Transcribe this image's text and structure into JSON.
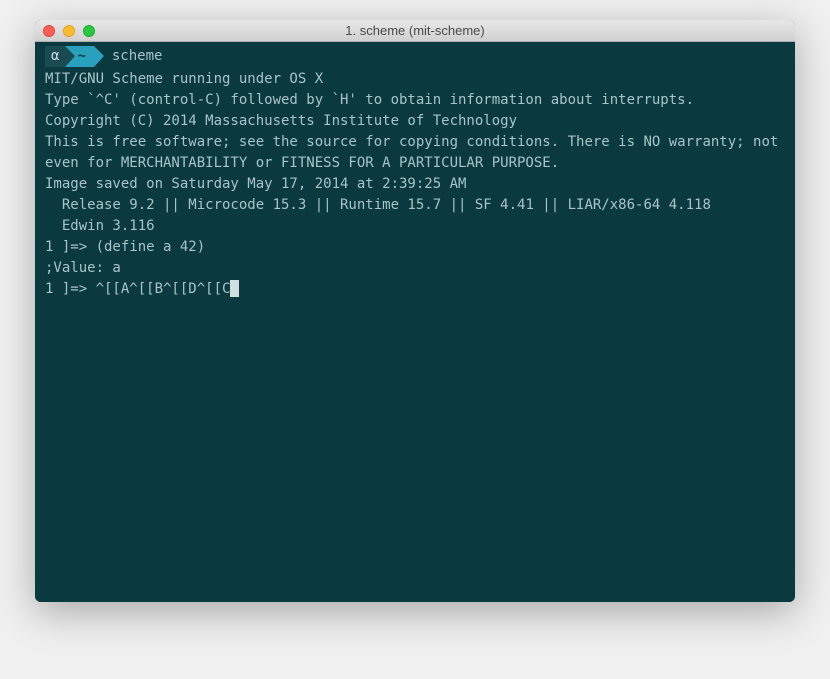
{
  "window": {
    "title": "1. scheme (mit-scheme)"
  },
  "prompt": {
    "alpha": "α",
    "tilde": "~",
    "command": "scheme"
  },
  "lines": {
    "l0": "MIT/GNU Scheme running under OS X",
    "l1": "Type `^C' (control-C) followed by `H' to obtain information about interrupts.",
    "l2": "",
    "l3": "Copyright (C) 2014 Massachusetts Institute of Technology",
    "l4": "This is free software; see the source for copying conditions. There is NO warranty; not even for MERCHANTABILITY or FITNESS FOR A PARTICULAR PURPOSE.",
    "l5": "",
    "l6": "Image saved on Saturday May 17, 2014 at 2:39:25 AM",
    "l7": "  Release 9.2 || Microcode 15.3 || Runtime 15.7 || SF 4.41 || LIAR/x86-64 4.118",
    "l8": "  Edwin 3.116",
    "l9": "",
    "l10": "1 ]=> (define a 42)",
    "l11": "",
    "l12": ";Value: a",
    "l13": "",
    "l14": "1 ]=> ^[[A^[[B^[[D^[[C"
  }
}
